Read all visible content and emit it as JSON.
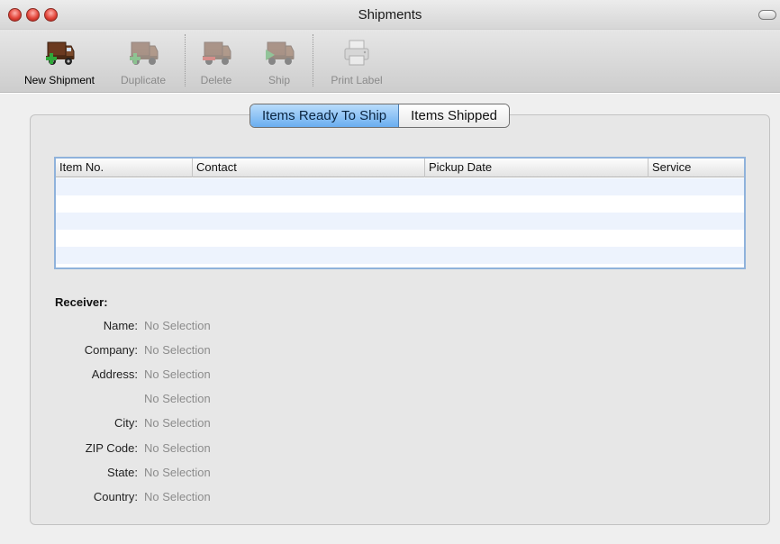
{
  "window": {
    "title": "Shipments"
  },
  "toolbar": {
    "items": [
      {
        "label": "New Shipment",
        "icon": "truck-add-icon",
        "enabled": true
      },
      {
        "label": "Duplicate",
        "icon": "truck-duplicate-icon",
        "enabled": false
      },
      {
        "label": "Delete",
        "icon": "truck-delete-icon",
        "enabled": false
      },
      {
        "label": "Ship",
        "icon": "truck-ship-icon",
        "enabled": false
      },
      {
        "label": "Print Label",
        "icon": "printer-icon",
        "enabled": false
      }
    ]
  },
  "tabs": {
    "items": [
      {
        "label": "Items Ready To Ship",
        "active": true
      },
      {
        "label": "Items Shipped",
        "active": false
      }
    ]
  },
  "table": {
    "columns": [
      "Item No.",
      "Contact",
      "Pickup Date",
      "Service"
    ],
    "rows": []
  },
  "receiver": {
    "title": "Receiver:",
    "fields": [
      {
        "label": "Name:",
        "value": "No Selection"
      },
      {
        "label": "Company:",
        "value": "No Selection"
      },
      {
        "label": "Address:",
        "value": "No Selection"
      },
      {
        "label": "",
        "value": "No Selection"
      },
      {
        "label": "City:",
        "value": "No Selection"
      },
      {
        "label": "ZIP Code:",
        "value": "No Selection"
      },
      {
        "label": "State:",
        "value": "No Selection"
      },
      {
        "label": "Country:",
        "value": "No Selection"
      }
    ]
  },
  "colors": {
    "tab_active": "#6aaef0",
    "table_border": "#8fb2db",
    "alt_row": "#edf3fd",
    "disabled_text": "#8a8a8a",
    "placeholder_text": "#8c8c8c"
  }
}
